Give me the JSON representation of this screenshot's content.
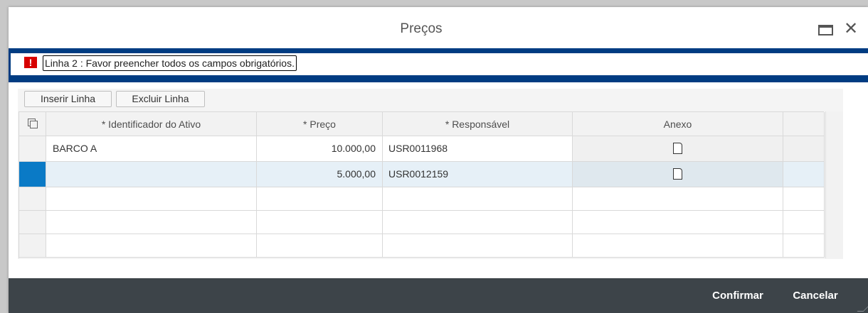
{
  "dialog": {
    "title": "Preços"
  },
  "message": {
    "icon": "error-icon",
    "icon_glyph": "!",
    "text": "Linha 2 : Favor preencher todos os campos obrigatórios."
  },
  "toolbar": {
    "insert_label": "Inserir Linha",
    "delete_label": "Excluir Linha"
  },
  "table": {
    "columns": [
      "* Identificador do Ativo",
      "* Preço",
      "* Responsável",
      "Anexo"
    ],
    "rows": [
      {
        "identificador": "BARCO A",
        "preco": "10.000,00",
        "responsavel": "USR0011968",
        "anexo_icon": "document-icon"
      },
      {
        "identificador": "",
        "preco": "5.000,00",
        "responsavel": "USR0012159",
        "anexo_icon": "document-icon",
        "selected": true
      }
    ]
  },
  "footer": {
    "confirm_label": "Confirmar",
    "cancel_label": "Cancelar"
  },
  "colors": {
    "message_border": "#003c82",
    "error": "#d70000",
    "selected_row": "#e6f0f7",
    "selected_indicator": "#0a7ac6",
    "footer_bg": "#3d4449"
  }
}
